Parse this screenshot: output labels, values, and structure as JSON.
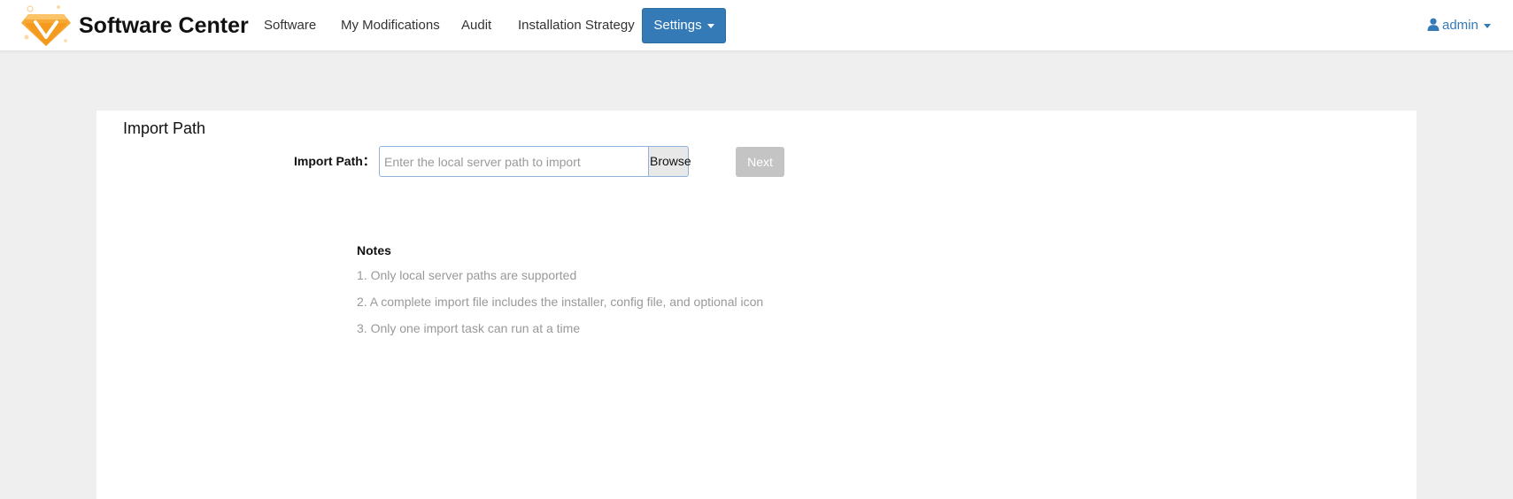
{
  "app": {
    "title": "Software Center",
    "logo_icon": "diamond-v-logo",
    "accent_color": "#337ab7"
  },
  "nav": {
    "items": [
      {
        "label": "Software"
      },
      {
        "label": "My Modifications"
      },
      {
        "label": "Audit"
      },
      {
        "label": "Installation Strategy"
      }
    ],
    "settings_label": "Settings",
    "user_label": "admin",
    "user_icon": "user-icon"
  },
  "panel": {
    "title": "Import Path",
    "path_label": "Import Path：",
    "path_value": "",
    "path_placeholder": "Enter the local server path to import",
    "browse_label": "Browse",
    "next_label": "Next",
    "notes_title": "Notes",
    "notes": [
      "1. Only local server paths are supported",
      "2. A complete import file includes the installer, config file, and optional icon",
      "3. Only one import task can run at a time"
    ]
  }
}
